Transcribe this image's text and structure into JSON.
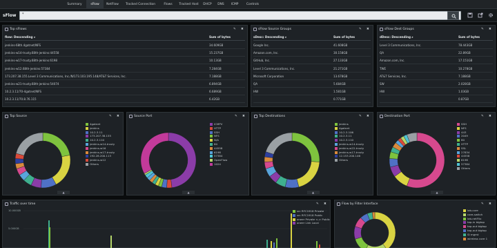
{
  "nav": [
    "Summary",
    "sFlow",
    "NetFlow",
    "Tracked Connection",
    "Flows",
    "Tracked Host",
    "DHCP",
    "DNS",
    "ICMP",
    "Controls"
  ],
  "nav_active_index": 1,
  "app_title": "sFlow",
  "search": {
    "value": "*"
  },
  "top_sflows": {
    "title": "Top sFlows",
    "col1": "flow: Descending",
    "col2": "Sum of bytes",
    "rows": [
      [
        "jenkins-68th.4gatnet/NFS",
        "34.609GB"
      ],
      [
        "jenkins-w14-trusty.68th-jenkins:44558",
        "15.237GB"
      ],
      [
        "jenkins-w17-trusty.68th-jenkins:6198",
        "10.13GB"
      ],
      [
        "jenkins-w12.68th-jenkins:57384",
        "7.284GB"
      ],
      [
        "173.207.38.155.Level 3 Communications, Inc./N/173.103.195.148/AT&T Services, Inc.",
        "7.188GB"
      ],
      [
        "jenkins-w21-trusty.68th-jenkins:54074",
        "6.894GB"
      ],
      [
        "10.2.3.11/70-4gatnet/NFS",
        "6.689GB"
      ],
      [
        "10.2.3.11/70.8.76.115",
        "6.42GB"
      ]
    ]
  },
  "src_groups": {
    "title": "sFlow Source Groups",
    "col1": "sDesc: Descending",
    "col2": "Sum of bytes",
    "rows": [
      [
        "Google Inc.",
        "41.608GB"
      ],
      [
        "Amazon.com, Inc.",
        "30.158GB"
      ],
      [
        "GitHub, Inc.",
        "27.133GB"
      ],
      [
        "Level 3 Communications, Inc.",
        "21.271GB"
      ],
      [
        "Microsoft Corporation",
        "13.678GB"
      ],
      [
        "QA",
        "5.684GB"
      ],
      [
        "HW",
        "1.581GB"
      ],
      [
        "",
        "0.771GB"
      ]
    ]
  },
  "dst_groups": {
    "title": "sFlow Dest Groups",
    "col1": "dDesc: Descending",
    "col2": "Sum of bytes",
    "rows": [
      [
        "Level 3 Communications, Inc.",
        "78.443GB"
      ],
      [
        "QA",
        "22.89GB"
      ],
      [
        "Amazon.com, Inc.",
        "17.151GB"
      ],
      [
        "TWE",
        "10.278GB"
      ],
      [
        "AT&T Services, Inc.",
        "7.188GB"
      ],
      [
        "SW",
        "2.028GB"
      ],
      [
        "HW",
        "1.03GB"
      ],
      [
        "",
        "0.87GB"
      ]
    ]
  },
  "top_source": {
    "title": "Top Source",
    "legend": [
      "4gatnet",
      "jenkins",
      "10.2.3.11",
      "173.207.38.155",
      "10.2.3.110",
      "jenkins-w14-trusty",
      "jenkins-w16",
      "jenkins-w17-trusty",
      "192.28.200.113",
      "jenkins-w12",
      "Others"
    ]
  },
  "source_port": {
    "title": "Source Port",
    "legend": [
      "ICMPV",
      "HTTP",
      "SSH",
      "NFS",
      "N/A",
      "80",
      "44558",
      "6198",
      "57384",
      "OpenFlow",
      "1024"
    ]
  },
  "top_dest": {
    "title": "Top Destinations",
    "legend": [
      "jenkins",
      "4gatnet",
      "10.2.3.106",
      "10.2.3.11",
      "10.2.3.110",
      "jenkins-w14-trusty",
      "jenkins-w22-trusty",
      "jenkins-w17-trusty",
      "12.153.200.146",
      "Others"
    ]
  },
  "dest_port": {
    "title": "Destination Port",
    "legend": [
      "SSH",
      "NFS",
      "443",
      "2049",
      "80",
      "HTTP",
      "SSL",
      "27834",
      "44558",
      "6198",
      "57384",
      "Others"
    ]
  },
  "traffic": {
    "title": "Traffic over time",
    "legend": [
      "src RFC1918 Private",
      "src RFC1918 Public",
      "oneer Private <-> Public",
      "oneer Link Local"
    ],
    "yticks": [
      "10.000GB",
      "5.000GB"
    ]
  },
  "pie_filter": {
    "title": "Flow by Filter Interface",
    "legend": [
      "lab-core",
      "core-switch",
      "lab-netFlix",
      "tap-in bigtop",
      "tap-out bigtop",
      "tap-out bigtop",
      "SI mgmt",
      "wireless core 1"
    ]
  },
  "colors": {
    "green": "#7ec33e",
    "blue": "#4f71c6",
    "purple": "#8b3ca8",
    "teal": "#3fb08f",
    "pink": "#d6498e",
    "yellow": "#d9d342",
    "lblue": "#59a5dc",
    "orange": "#d98a3d",
    "red": "#d94a3a",
    "gray": "#9aa0a4",
    "dkblue": "#2d3f9e",
    "lgreen": "#b5d66b",
    "magenta": "#c23a9a",
    "cyan": "#4fc4d4"
  }
}
